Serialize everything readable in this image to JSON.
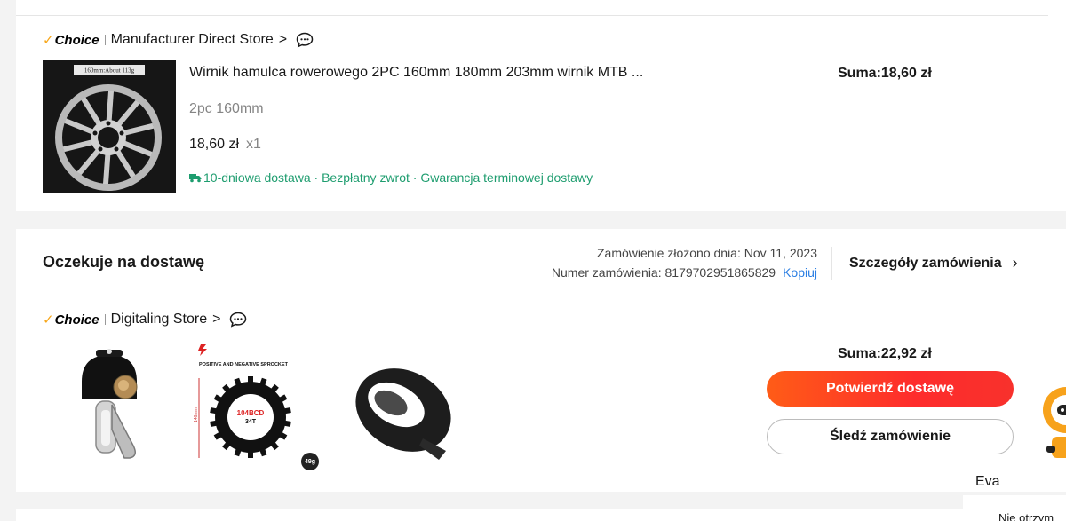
{
  "order1": {
    "store": {
      "badge": "Choice",
      "name": "Manufacturer Direct Store",
      "chevron": ">",
      "chat_icon": "chat-bubble-icon"
    },
    "product": {
      "title": "Wirnik hamulca rowerowego 2PC 160mm 180mm 203mm wirnik MTB ...",
      "variant": "2pc 160mm",
      "price": "18,60 zł",
      "qty": "x1",
      "image_caption": "160mm:About 113g",
      "delivery": "10-dniowa dostawa · Bezpłatny zwrot · Gwarancja terminowej dostawy"
    },
    "sum": "Suma:18,60 zł"
  },
  "order2": {
    "status": "Oczekuje na dostawę",
    "placed_on": "Zamówienie złożono dnia: Nov 11, 2023",
    "order_number": "Numer zamówienia: 8179702951865829",
    "copy_label": "Kopiuj",
    "details_label": "Szczegóły zamówienia",
    "store": {
      "badge": "Choice",
      "name": "Digitaling Store",
      "chevron": ">",
      "chat_icon": "chat-bubble-icon"
    },
    "sprocket_image": {
      "heading": "POSITIVE AND NEGATIVE SPROCKET",
      "bcd": "104BCD",
      "teeth": "34T",
      "dimension": "146mm",
      "weight": "49g"
    },
    "sum": "Suma:22,92 zł",
    "confirm_button": "Potwierdź dostawę",
    "track_button": "Śledź zamówienie"
  },
  "assistant": {
    "name": "Eva",
    "message": "Nie otrzym"
  },
  "colors": {
    "accent_orange": "#fe4a1e",
    "delivery_green": "#1e9d6f",
    "link_blue": "#2a7ee3",
    "choice_check": "#f7a71b"
  }
}
